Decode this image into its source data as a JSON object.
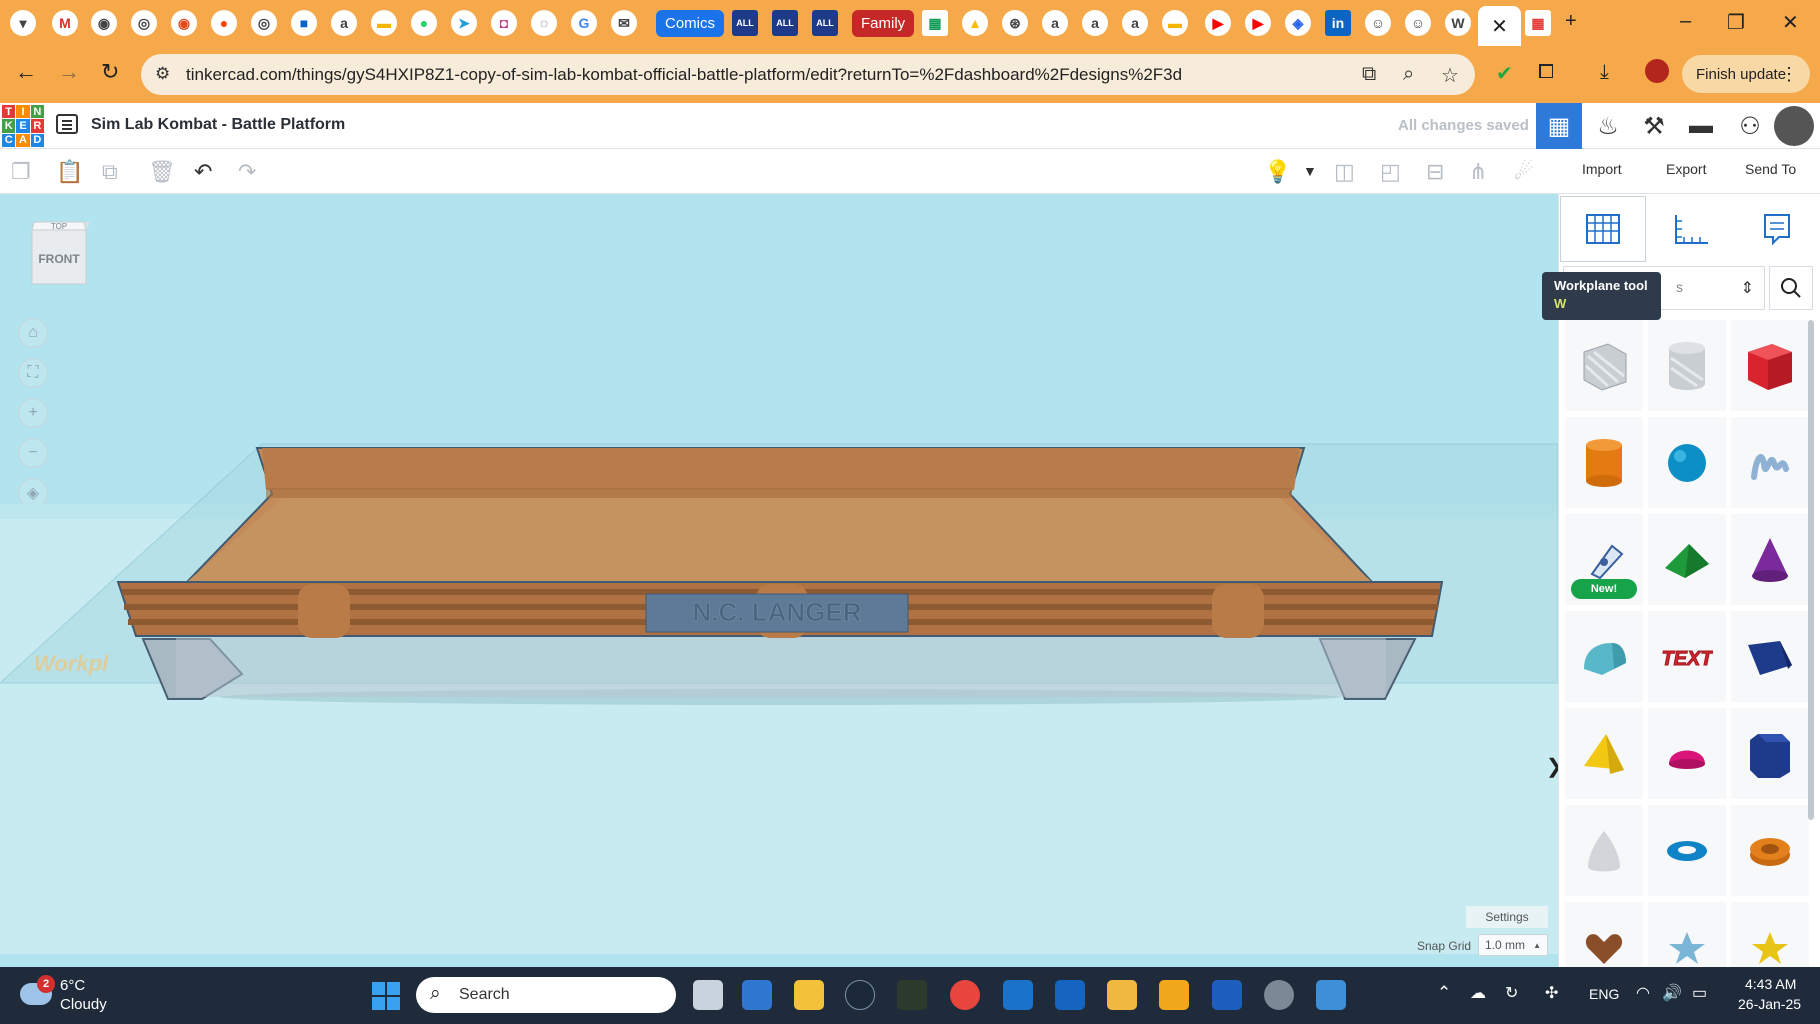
{
  "browser": {
    "tabs": [
      {
        "label": "Comics",
        "color": "#1a73e8"
      },
      {
        "label": "Family",
        "color": "#c62828"
      }
    ],
    "window_controls": {
      "minimize": "–",
      "restore": "❐",
      "close": "✕"
    },
    "url": "tinkercad.com/things/gyS4HXIP8Z1-copy-of-sim-lab-kombat-official-battle-platform/edit?returnTo=%2Fdashboard%2Fdesigns%2F3d",
    "finish_update_label": "Finish update"
  },
  "app": {
    "logo_letters": [
      "T",
      "I",
      "N",
      "K",
      "E",
      "R",
      "C",
      "A",
      "D"
    ],
    "design_title": "Sim Lab Kombat - Battle Platform",
    "save_status": "All changes saved"
  },
  "toolbar": {
    "import_label": "Import",
    "export_label": "Export",
    "send_to_label": "Send To"
  },
  "viewport": {
    "viewcube_top": "TOP",
    "viewcube_front": "FRONT",
    "workplane_watermark": "Workpl",
    "nameplate_text": "N.C. LANGER",
    "settings_label": "Settings",
    "snap_grid_label": "Snap Grid",
    "snap_grid_value": "1.0 mm",
    "colors": {
      "sky": "#b2e4ef",
      "platform": "#c48a5a",
      "platform_dark": "#a8703f",
      "nameplate": "#5d7a96"
    }
  },
  "panel": {
    "tooltip_title": "Workplane tool",
    "tooltip_shortcut": "W",
    "shape_select_hint": "s",
    "new_badge": "New!",
    "shapes": [
      "box-hole-icon",
      "cylinder-hole-icon",
      "box-icon",
      "cylinder-icon",
      "sphere-icon",
      "scribble-icon",
      "sketch-icon",
      "roof-icon",
      "cone-icon",
      "round-roof-icon",
      "text-icon",
      "wedge-icon",
      "pyramid-icon",
      "half-sphere-icon",
      "polygon-icon",
      "paraboloid-icon",
      "torus-icon",
      "tube-icon",
      "heart-icon",
      "star-icon",
      "star-gold-icon"
    ]
  },
  "taskbar": {
    "weather_badge": "2",
    "temperature": "6°C",
    "weather": "Cloudy",
    "search_label": "Search",
    "language": "ENG",
    "time": "4:43 AM",
    "date": "26-Jan-25"
  }
}
